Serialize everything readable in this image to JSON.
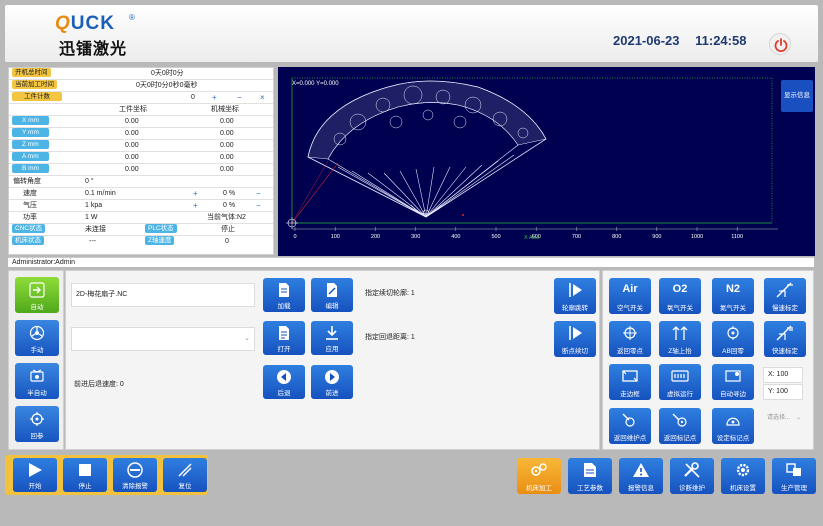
{
  "header": {
    "brand": "UCK",
    "brand_q": "Q",
    "brand_reg": "®",
    "brand_cn": "迅镭激光",
    "date": "2021-06-23",
    "time": "11:24:58"
  },
  "status": {
    "boot_time_label": "开机总时间",
    "boot_time_value": "0天0时0分",
    "proc_time_label": "当前加工时间",
    "proc_time_value": "0天0时0分0秒0毫秒",
    "count_label": "工件计数",
    "count_value": "0",
    "count_plus": "+",
    "count_minus": "−",
    "count_clear": "×",
    "col_work": "工件坐标",
    "col_machine": "机械坐标",
    "axes": [
      {
        "label": "X mm",
        "work": "0.00",
        "machine": "0.00"
      },
      {
        "label": "Y mm",
        "work": "0.00",
        "machine": "0.00"
      },
      {
        "label": "Z mm",
        "work": "0.00",
        "machine": "0.00"
      },
      {
        "label": "A mm",
        "work": "0.00",
        "machine": "0.00"
      },
      {
        "label": "B mm",
        "work": "0.00",
        "machine": "0.00"
      }
    ],
    "rotate_label": "偏转角度",
    "rotate_value": "0 °",
    "speed_label": "速度",
    "speed_value": "0.1 m/min",
    "speed_pct": "0 %",
    "pressure_label": "气压",
    "pressure_value": "1 kpa",
    "pressure_pct": "0 %",
    "power_label": "功率",
    "power_value": "1 W",
    "gas_label": "当前气体:N2",
    "plus": "+",
    "minus": "−",
    "cnc_label": "CNC状态",
    "cnc_value": "未连接",
    "plc_label": "PLC状态",
    "plc_value": "停止",
    "machine_label": "机床状态",
    "machine_value": "---",
    "zspeed_label": "Z轴速度",
    "zspeed_value": "0"
  },
  "canvas": {
    "coord_readout": "X=0.000  Y=0.000",
    "xaxis_label": "X  Axis",
    "ticks": [
      "0",
      "100",
      "200",
      "300",
      "400",
      "500",
      "600",
      "700",
      "800",
      "900",
      "1000",
      "1100"
    ]
  },
  "show_info_label": "显示信息",
  "user": "Administrator:Admin",
  "modes": [
    {
      "label": "自动"
    },
    {
      "label": "手动"
    },
    {
      "label": "半自动"
    },
    {
      "label": "回参"
    }
  ],
  "file": {
    "filename": "2D-梅花扇子.NC",
    "back_speed": "前进后退速度: 0",
    "load_label": "加载",
    "edit_label": "编辑",
    "open_label": "打开",
    "apply_label": "应用",
    "back_label": "后退",
    "forward_label": "前进",
    "resume_contour": "指定续切轮廓: 1",
    "return_distance": "指定回退距离: 1",
    "contour_jump_label": "轮廓跳转",
    "breakpoint_label": "断点续切"
  },
  "gas": {
    "air_big": "Air",
    "air_label": "空气开关",
    "o2_big": "O2",
    "o2_label": "氧气开关",
    "n2_big": "N2",
    "n2_label": "氮气开关",
    "slow_cal_label": "慢速标定",
    "return_zero_label": "返回零点",
    "z_up_label": "Z轴上抬",
    "ab_zero_label": "AB回零",
    "fast_cal_label": "快速标定",
    "border_label": "走边框",
    "virtual_run_label": "虚拟运行",
    "auto_edge_label": "自动寻边",
    "x_coord": "X: 100",
    "y_coord": "Y: 100",
    "return_maint_label": "返回维护点",
    "return_mark_label": "返回标记点",
    "set_mark_label": "设定标记点",
    "select_placeholder": "请选择..."
  },
  "run": {
    "start_label": "开始",
    "stop_label": "停止",
    "clear_alarm_label": "清除报警",
    "reset_label": "复位"
  },
  "nav": [
    {
      "label": "机床加工"
    },
    {
      "label": "工艺参数"
    },
    {
      "label": "报警信息"
    },
    {
      "label": "诊断维护"
    },
    {
      "label": "机床设置"
    },
    {
      "label": "生产管理"
    }
  ],
  "colors": {
    "accent_blue": "#1a55c0",
    "active_green": "#5bb322",
    "active_orange": "#ee961b",
    "tag_yellow": "#f4c541",
    "canvas_bg": "#000050"
  }
}
